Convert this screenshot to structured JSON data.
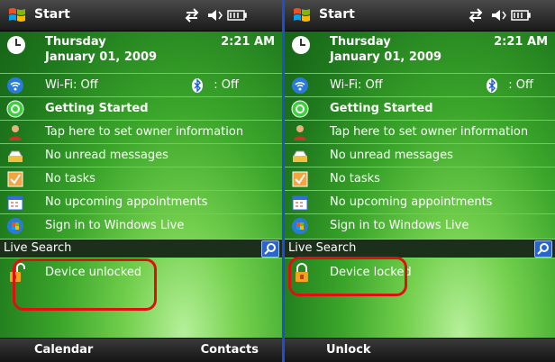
{
  "title": "Start",
  "date": {
    "day": "Thursday",
    "date": "January 01, 2009",
    "time": "2:21 AM"
  },
  "connectivity": {
    "wifi": "Wi-Fi: Off",
    "bluetooth": ": Off"
  },
  "items": [
    {
      "label": "Getting Started",
      "icon": "getting-started-icon"
    },
    {
      "label": "Tap here to set owner information",
      "icon": "owner-icon"
    },
    {
      "label": "No unread messages",
      "icon": "messages-icon"
    },
    {
      "label": "No tasks",
      "icon": "tasks-icon"
    },
    {
      "label": "No upcoming appointments",
      "icon": "calendar-icon"
    },
    {
      "label": "Sign in to Windows Live",
      "icon": "windows-live-icon"
    }
  ],
  "search": {
    "placeholder": "Live Search"
  },
  "left": {
    "lock_status": "Device unlocked",
    "softkey_left": "Calendar",
    "softkey_right": "Contacts"
  },
  "right": {
    "lock_status": "Device locked",
    "softkey_left": "Unlock"
  },
  "colors": {
    "highlight": "#e01010",
    "divider": "#1a4fd8",
    "separator": "#67d254"
  }
}
